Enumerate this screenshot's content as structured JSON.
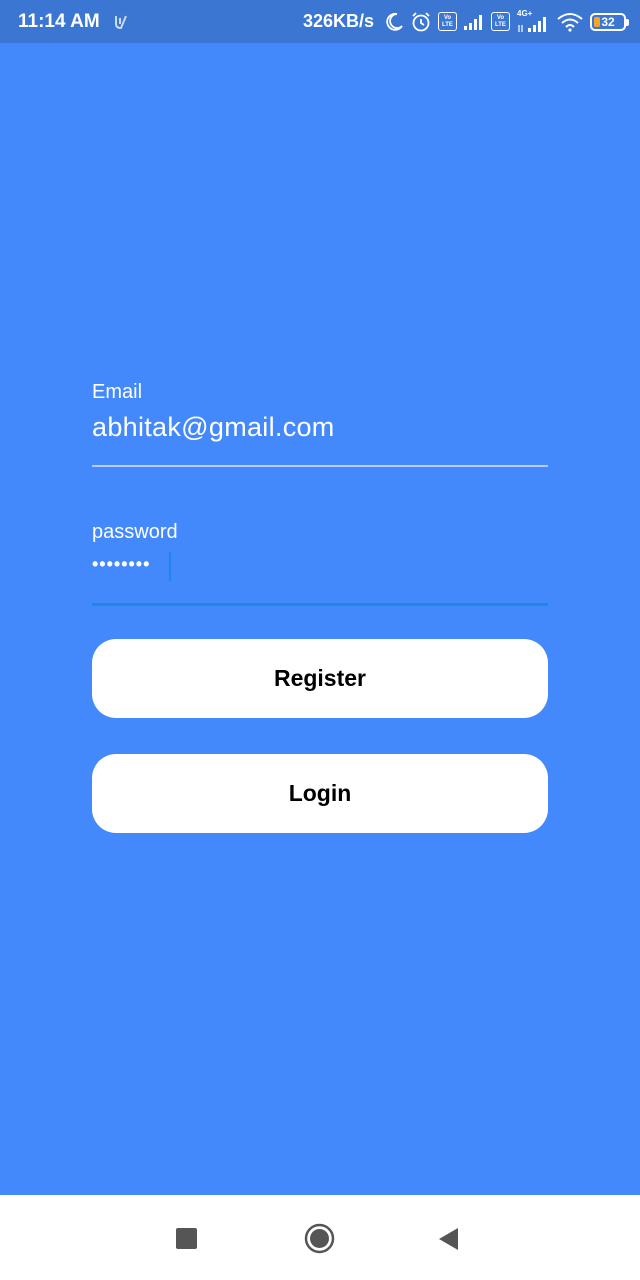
{
  "status_bar": {
    "time": "11:14 AM",
    "network_speed": "326KB/s",
    "volte_label_top": "Vo",
    "volte_label_bottom": "LTE",
    "network_type": "4G+",
    "battery_level": "32",
    "battery_accent_color": "#f5a623",
    "icons": [
      "app-notification-icon",
      "moon-icon",
      "alarm-icon",
      "volte-icon",
      "signal-icon",
      "volte-icon",
      "signal-4g-icon",
      "wifi-icon",
      "battery-icon"
    ]
  },
  "form": {
    "email": {
      "label": "Email",
      "value": "abhitak@gmail.com"
    },
    "password": {
      "label": "password",
      "value": "••••••••"
    }
  },
  "buttons": {
    "register_label": "Register",
    "login_label": "Login"
  },
  "nav_bar": {
    "icons": [
      "recents-square-icon",
      "home-circle-icon",
      "back-triangle-icon"
    ]
  },
  "colors": {
    "background": "#4389fc",
    "status_bar": "#3a76d2",
    "focus_accent": "#1e88e5",
    "button": "#ffffff"
  }
}
